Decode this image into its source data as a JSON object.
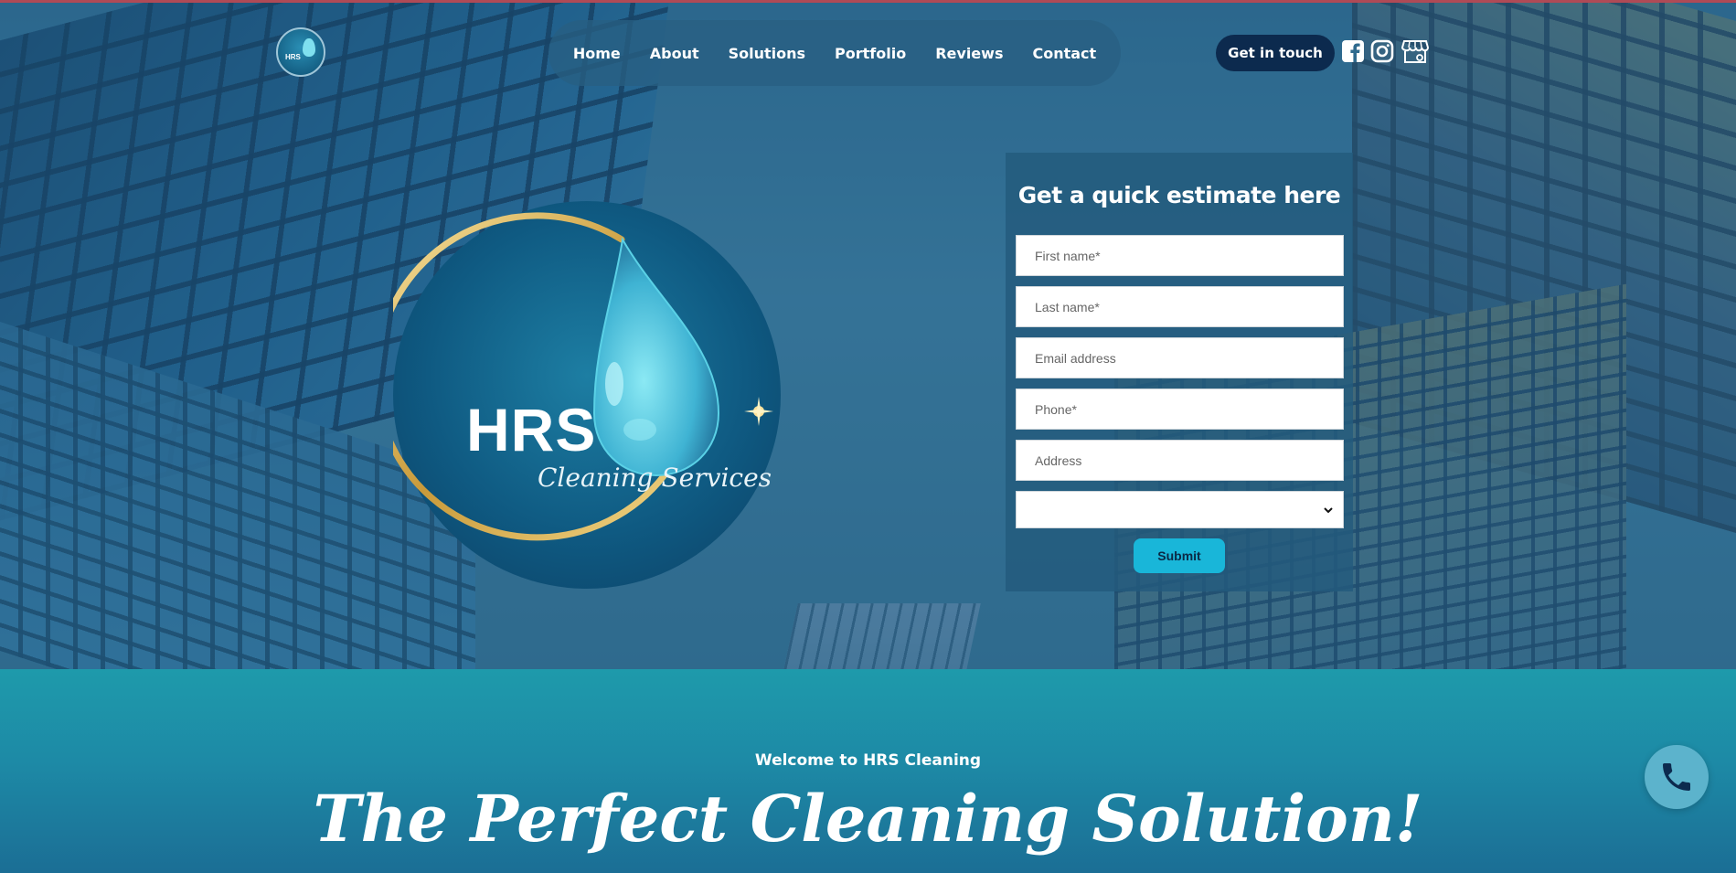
{
  "nav": {
    "logo_text": "HRS",
    "items": [
      {
        "label": "Home"
      },
      {
        "label": "About"
      },
      {
        "label": "Solutions"
      },
      {
        "label": "Portfolio"
      },
      {
        "label": "Reviews"
      },
      {
        "label": "Contact"
      }
    ],
    "cta_label": "Get in touch",
    "social_icons": [
      "facebook-icon",
      "instagram-icon",
      "storefront-icon"
    ]
  },
  "hero_logo": {
    "brand": "HRS",
    "tagline": "Cleaning Services"
  },
  "form": {
    "title": "Get a quick estimate here",
    "fields": [
      {
        "placeholder": "First name*"
      },
      {
        "placeholder": "Last name*"
      },
      {
        "placeholder": "Email address"
      },
      {
        "placeholder": "Phone*"
      },
      {
        "placeholder": "Address"
      }
    ],
    "select_value": "",
    "submit_label": "Submit"
  },
  "welcome": {
    "eyebrow": "Welcome to HRS Cleaning",
    "headline": "The Perfect Cleaning Solution!"
  },
  "colors": {
    "accent": "#19b6d9",
    "nav_dark": "#0c2a4e",
    "section_teal": "#1e9aab"
  }
}
